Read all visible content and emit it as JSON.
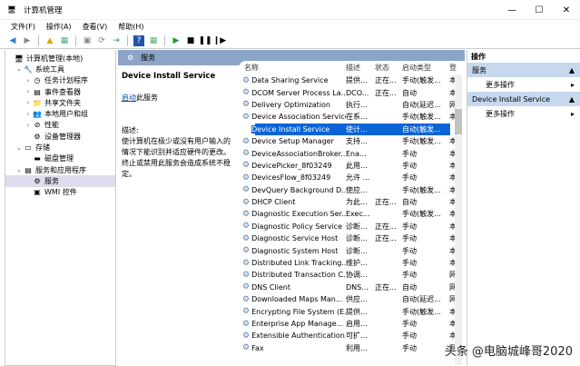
{
  "window": {
    "title": "计算机管理",
    "min": "—",
    "max": "☐",
    "close": "✕"
  },
  "menu": [
    "文件(F)",
    "操作(A)",
    "查看(V)",
    "帮助(H)"
  ],
  "tree": [
    {
      "label": "计算机管理(本地)",
      "level": 0,
      "arrow": "",
      "icon": "computer-icon"
    },
    {
      "label": "系统工具",
      "level": 1,
      "arrow": "⌄",
      "icon": "tools-icon"
    },
    {
      "label": "任务计划程序",
      "level": 2,
      "arrow": "›",
      "icon": "clock-icon"
    },
    {
      "label": "事件查看器",
      "level": 2,
      "arrow": "›",
      "icon": "event-viewer-icon"
    },
    {
      "label": "共享文件夹",
      "level": 2,
      "arrow": "›",
      "icon": "shared-folder-icon"
    },
    {
      "label": "本地用户和组",
      "level": 2,
      "arrow": "›",
      "icon": "users-icon"
    },
    {
      "label": "性能",
      "level": 2,
      "arrow": "›",
      "icon": "performance-icon"
    },
    {
      "label": "设备管理器",
      "level": 2,
      "arrow": "",
      "icon": "device-manager-icon"
    },
    {
      "label": "存储",
      "level": 1,
      "arrow": "⌄",
      "icon": "storage-icon"
    },
    {
      "label": "磁盘管理",
      "level": 2,
      "arrow": "",
      "icon": "disk-icon"
    },
    {
      "label": "服务和应用程序",
      "level": 1,
      "arrow": "⌄",
      "icon": "services-apps-icon"
    },
    {
      "label": "服务",
      "level": 2,
      "arrow": "",
      "icon": "services-icon",
      "selected": true
    },
    {
      "label": "WMI 控件",
      "level": 2,
      "arrow": "",
      "icon": "wmi-icon"
    }
  ],
  "middle": {
    "header": "服务",
    "service_title": "Device Install Service",
    "start_link": "启动",
    "start_suffix": "此服务",
    "desc_label": "描述:",
    "desc_text": "使计算机在极少或没有用户输入的情况下能识别并适应硬件的更改。终止或禁用此服务会造成系统不稳定。"
  },
  "columns": [
    "名称",
    "描述",
    "状态",
    "启动类型",
    "登"
  ],
  "services": [
    [
      "Data Sharing Service",
      "提供...",
      "正在...",
      "手动(触发...",
      "本"
    ],
    [
      "DCOM Server Process La...",
      "DCO...",
      "正在...",
      "自动",
      "本"
    ],
    [
      "Delivery Optimization",
      "执行...",
      "",
      "自动(延迟...",
      "网"
    ],
    [
      "Device Association Service",
      "在系...",
      "",
      "手动(触发...",
      "本"
    ],
    [
      "Device Install Service",
      "使计...",
      "",
      "自动(触发...",
      "本"
    ],
    [
      "Device Setup Manager",
      "支持...",
      "",
      "手动(触发...",
      "本"
    ],
    [
      "DeviceAssociationBroker...",
      "Ena...",
      "",
      "手动",
      "本"
    ],
    [
      "DevicePicker_8f03249",
      "此用...",
      "",
      "手动",
      "本"
    ],
    [
      "DevicesFlow_8f03249",
      "允许 ...",
      "",
      "手动",
      "本"
    ],
    [
      "DevQuery Background D...",
      "使应...",
      "",
      "手动(触发...",
      "本"
    ],
    [
      "DHCP Client",
      "为此...",
      "正在...",
      "自动",
      "本"
    ],
    [
      "Diagnostic Execution Ser...",
      "Exec...",
      "",
      "手动(触发...",
      "本"
    ],
    [
      "Diagnostic Policy Service",
      "诊断...",
      "正在...",
      "手动",
      "本"
    ],
    [
      "Diagnostic Service Host",
      "诊断...",
      "正在...",
      "手动",
      "本"
    ],
    [
      "Diagnostic System Host",
      "诊断...",
      "",
      "手动",
      "本"
    ],
    [
      "Distributed Link Tracking...",
      "维护...",
      "",
      "手动",
      "本"
    ],
    [
      "Distributed Transaction C...",
      "协调...",
      "",
      "手动",
      "网"
    ],
    [
      "DNS Client",
      "DNS...",
      "正在...",
      "自动",
      "网"
    ],
    [
      "Downloaded Maps Man...",
      "供应...",
      "",
      "自动(延迟...",
      "网"
    ],
    [
      "Encrypting File System (E...",
      "提供...",
      "",
      "手动(触发...",
      "本"
    ],
    [
      "Enterprise App Manage...",
      "启用...",
      "",
      "手动",
      "本"
    ],
    [
      "Extensible Authentication...",
      "可扩...",
      "",
      "手动",
      "本"
    ],
    [
      "Fax",
      "利用...",
      "",
      "手动",
      "网"
    ]
  ],
  "selected_index": 4,
  "actions": {
    "header": "操作",
    "sections": [
      {
        "title": "服务",
        "item": "更多操作"
      },
      {
        "title": "Device Install Service",
        "item": "更多操作"
      }
    ]
  },
  "watermark": "头条 @电脑城峰哥2020"
}
